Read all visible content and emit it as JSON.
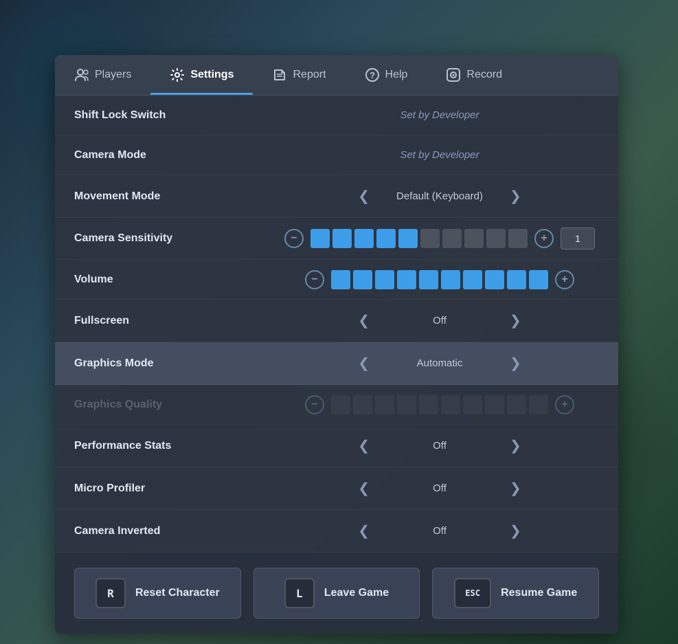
{
  "background": {
    "color": "#2a3a4a"
  },
  "tabs": [
    {
      "id": "players",
      "label": "Players",
      "active": false,
      "icon": "players-icon"
    },
    {
      "id": "settings",
      "label": "Settings",
      "active": true,
      "icon": "settings-icon"
    },
    {
      "id": "report",
      "label": "Report",
      "active": false,
      "icon": "report-icon"
    },
    {
      "id": "help",
      "label": "Help",
      "active": false,
      "icon": "help-icon"
    },
    {
      "id": "record",
      "label": "Record",
      "active": false,
      "icon": "record-icon"
    }
  ],
  "settings": [
    {
      "id": "shift-lock",
      "label": "Shift Lock Switch",
      "type": "static",
      "value": "Set by Developer",
      "disabled": false,
      "highlighted": false
    },
    {
      "id": "camera-mode",
      "label": "Camera Mode",
      "type": "static",
      "value": "Set by Developer",
      "disabled": false,
      "highlighted": false
    },
    {
      "id": "movement-mode",
      "label": "Movement Mode",
      "type": "arrow",
      "value": "Default (Keyboard)",
      "disabled": false,
      "highlighted": false
    },
    {
      "id": "camera-sensitivity",
      "label": "Camera Sensitivity",
      "type": "slider",
      "filled_blocks": 5,
      "total_blocks": 10,
      "input_value": "1",
      "disabled": false,
      "highlighted": false
    },
    {
      "id": "volume",
      "label": "Volume",
      "type": "slider-no-input",
      "filled_blocks": 10,
      "total_blocks": 10,
      "disabled": false,
      "highlighted": false
    },
    {
      "id": "fullscreen",
      "label": "Fullscreen",
      "type": "arrow",
      "value": "Off",
      "disabled": false,
      "highlighted": false
    },
    {
      "id": "graphics-mode",
      "label": "Graphics Mode",
      "type": "arrow",
      "value": "Automatic",
      "disabled": false,
      "highlighted": true
    },
    {
      "id": "graphics-quality",
      "label": "Graphics Quality",
      "type": "slider-disabled",
      "filled_blocks": 0,
      "total_blocks": 10,
      "disabled": true,
      "highlighted": false
    },
    {
      "id": "performance-stats",
      "label": "Performance Stats",
      "type": "arrow",
      "value": "Off",
      "disabled": false,
      "highlighted": false
    },
    {
      "id": "micro-profiler",
      "label": "Micro Profiler",
      "type": "arrow",
      "value": "Off",
      "disabled": false,
      "highlighted": false
    },
    {
      "id": "camera-inverted",
      "label": "Camera Inverted",
      "type": "arrow",
      "value": "Off",
      "disabled": false,
      "highlighted": false
    }
  ],
  "actions": [
    {
      "id": "reset",
      "key": "R",
      "label": "Reset Character"
    },
    {
      "id": "leave",
      "key": "L",
      "label": "Leave Game"
    },
    {
      "id": "resume",
      "key": "ESC",
      "label": "Resume Game"
    }
  ]
}
